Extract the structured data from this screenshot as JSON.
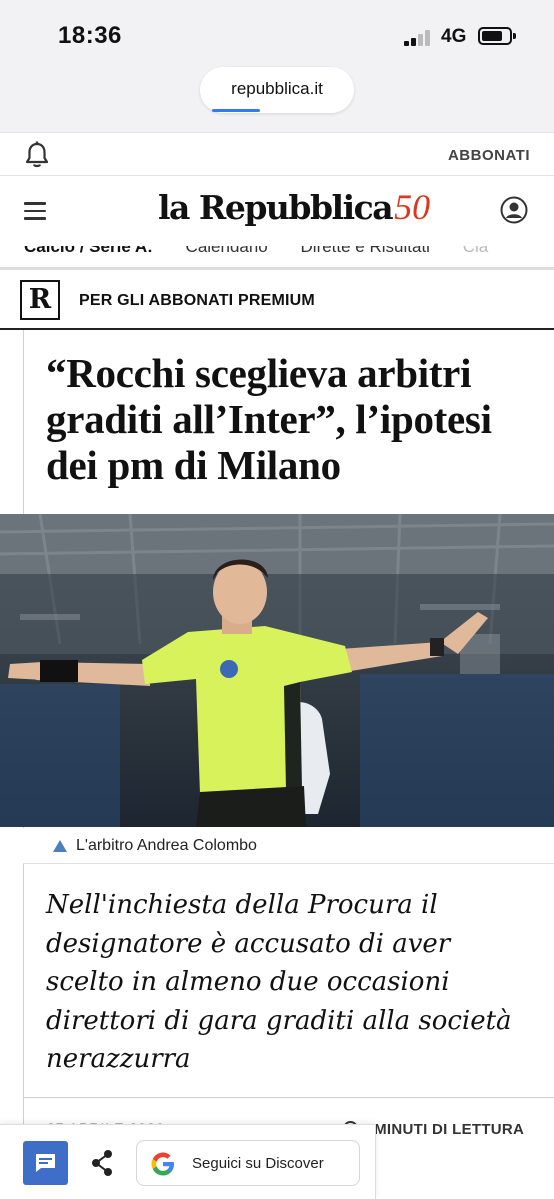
{
  "status_bar": {
    "time": "18:36",
    "network": "4G"
  },
  "browser": {
    "url": "repubblica.it"
  },
  "utility_bar": {
    "notifications_icon": "bell-icon",
    "subscribe_label": "ABBONATI"
  },
  "header": {
    "menu_icon": "hamburger-icon",
    "logo_text": "la Repubblica",
    "logo_anniversary": "50",
    "user_icon": "user-icon"
  },
  "subnav": {
    "items": [
      "Calcio / Serie A:",
      "Calendario",
      "Dirette e Risultati",
      "Cla"
    ]
  },
  "premium": {
    "badge": "R",
    "label": "PER GLI ABBONATI PREMIUM"
  },
  "article": {
    "headline": "“Rocchi sceglieva arbitri graditi all’Inter”, l’ipotesi dei pm di Milano",
    "photo_caption": "L'arbitro Andrea Colombo",
    "summary": "Nell'inchiesta della Procura il designatore è accusato di aver scelto in almeno due occasioni direttori di gara graditi alla società nerazzurra",
    "date": "27 APRILE 2026",
    "reading_time": "3 MINUTI DI LETTURA"
  },
  "toolbar": {
    "comment_icon": "comment-icon",
    "share_icon": "share-icon",
    "discover_label": "Seguici su Discover"
  },
  "colors": {
    "accent_red": "#d9381e",
    "button_blue": "#3e6ec8",
    "referee_shirt": "#d7f25a"
  }
}
